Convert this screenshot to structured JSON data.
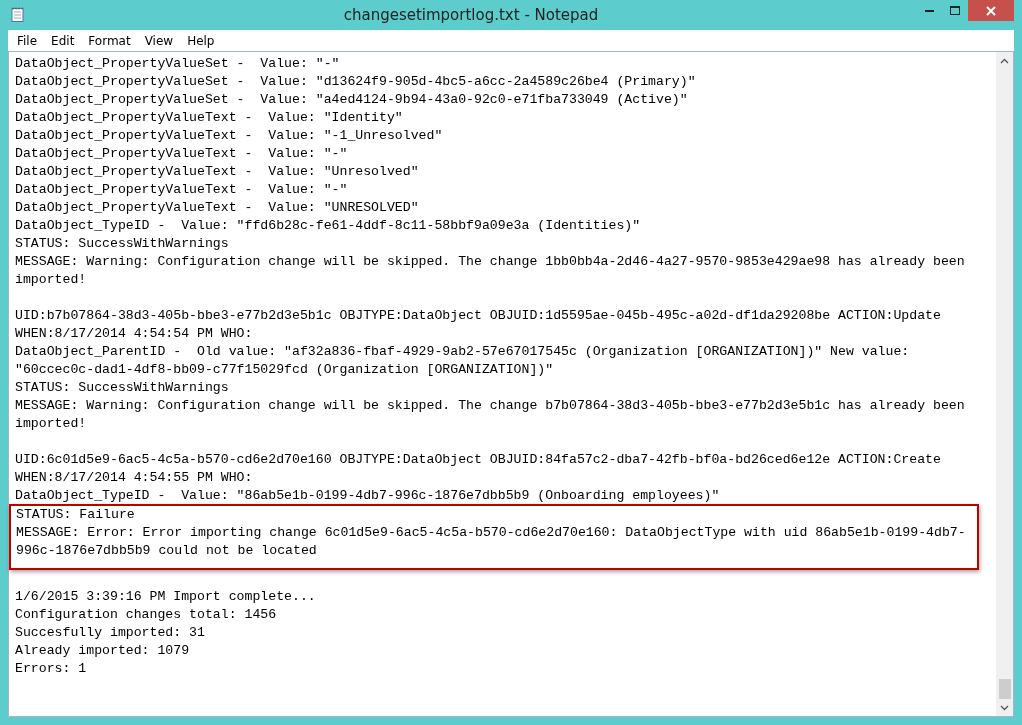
{
  "window": {
    "title": "changesetimportlog.txt - Notepad"
  },
  "menu": [
    {
      "label": "File"
    },
    {
      "label": "Edit"
    },
    {
      "label": "Format"
    },
    {
      "label": "View"
    },
    {
      "label": "Help"
    }
  ],
  "blocks": [
    {
      "blank_before": false,
      "highlighted": false,
      "lines": [
        "DataObject_PropertyValueSet -  Value: \"-\"",
        "DataObject_PropertyValueSet -  Value: \"d13624f9-905d-4bc5-a6cc-2a4589c26be4 (Primary)\"",
        "DataObject_PropertyValueSet -  Value: \"a4ed4124-9b94-43a0-92c0-e71fba733049 (Active)\"",
        "DataObject_PropertyValueText -  Value: \"Identity\"",
        "DataObject_PropertyValueText -  Value: \"-1_Unresolved\"",
        "DataObject_PropertyValueText -  Value: \"-\"",
        "DataObject_PropertyValueText -  Value: \"Unresolved\"",
        "DataObject_PropertyValueText -  Value: \"-\"",
        "DataObject_PropertyValueText -  Value: \"UNRESOLVED\"",
        "DataObject_TypeID -  Value: \"ffd6b28c-fe61-4ddf-8c11-58bbf9a09e3a (Identities)\"",
        "STATUS: SuccessWithWarnings",
        "MESSAGE: Warning: Configuration change will be skipped. The change 1bb0bb4a-2d46-4a27-9570-9853e429ae98 has already been",
        "imported!"
      ]
    },
    {
      "blank_before": true,
      "highlighted": false,
      "lines": [
        "UID:b7b07864-38d3-405b-bbe3-e77b2d3e5b1c OBJTYPE:DataObject OBJUID:1d5595ae-045b-495c-a02d-df1da29208be ACTION:Update",
        "WHEN:8/17/2014 4:54:54 PM WHO:",
        "DataObject_ParentID -  Old value: \"af32a836-fbaf-4929-9ab2-57e67017545c (Organization [ORGANIZATION])\" New value:",
        "\"60ccec0c-dad1-4df8-bb09-c77f15029fcd (Organization [ORGANIZATION])\"",
        "STATUS: SuccessWithWarnings",
        "MESSAGE: Warning: Configuration change will be skipped. The change b7b07864-38d3-405b-bbe3-e77b2d3e5b1c has already been",
        "imported!"
      ]
    },
    {
      "blank_before": true,
      "highlighted": false,
      "lines": [
        "UID:6c01d5e9-6ac5-4c5a-b570-cd6e2d70e160 OBJTYPE:DataObject OBJUID:84fa57c2-dba7-42fb-bf0a-bd26ced6e12e ACTION:Create",
        "WHEN:8/17/2014 4:54:55 PM WHO:",
        "DataObject_TypeID -  Value: \"86ab5e1b-0199-4db7-996c-1876e7dbb5b9 (Onboarding employees)\""
      ]
    },
    {
      "blank_before": false,
      "highlighted": true,
      "lines": [
        "STATUS: Failure",
        "MESSAGE: Error: Error importing change 6c01d5e9-6ac5-4c5a-b570-cd6e2d70e160: DataObjectType with uid 86ab5e1b-0199-4db7-",
        "996c-1876e7dbb5b9 could not be located"
      ]
    },
    {
      "blank_before": true,
      "highlighted": false,
      "lines": [
        "1/6/2015 3:39:16 PM Import complete...",
        "Configuration changes total: 1456",
        "Succesfully imported: 31",
        "Already imported: 1079",
        "Errors: 1"
      ]
    }
  ]
}
